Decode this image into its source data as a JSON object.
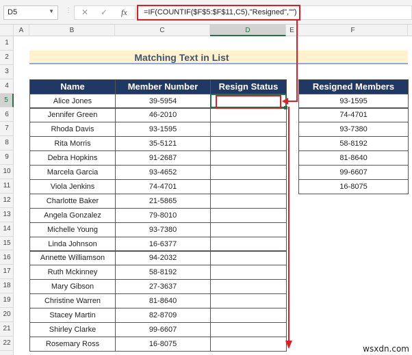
{
  "name_box": "D5",
  "formula_bar": {
    "cancel": "✕",
    "enter": "✓",
    "fx": "fx",
    "formula": "=IF(COUNTIF($F$5:$F$11,C5),\"Resigned\",\"\")"
  },
  "columns": [
    "A",
    "B",
    "C",
    "D",
    "E",
    "F"
  ],
  "rows": [
    "1",
    "2",
    "3",
    "4",
    "5",
    "6",
    "7",
    "8",
    "9",
    "10",
    "11",
    "12",
    "13",
    "14",
    "15",
    "16",
    "17",
    "18",
    "19",
    "20",
    "21",
    "22"
  ],
  "title": "Matching Text in List",
  "headers": {
    "name": "Name",
    "member_number": "Member Number",
    "resign_status": "Resign Status",
    "resigned_members": "Resigned Members"
  },
  "members": [
    {
      "name": "Alice Jones",
      "number": "39-5954",
      "status": ""
    },
    {
      "name": "Jennifer Green",
      "number": "46-2010",
      "status": ""
    },
    {
      "name": "Rhoda Davis",
      "number": "93-1595",
      "status": ""
    },
    {
      "name": "Rita Morris",
      "number": "35-5121",
      "status": ""
    },
    {
      "name": "Debra Hopkins",
      "number": "91-2687",
      "status": ""
    },
    {
      "name": "Marcela Garcia",
      "number": "93-4652",
      "status": ""
    },
    {
      "name": "Viola Jenkins",
      "number": "74-4701",
      "status": ""
    },
    {
      "name": "Charlotte Baker",
      "number": "21-5865",
      "status": ""
    },
    {
      "name": "Angela Gonzalez",
      "number": "79-8010",
      "status": ""
    },
    {
      "name": "Michelle Young",
      "number": "93-7380",
      "status": ""
    },
    {
      "name": "Linda Johnson",
      "number": "16-6377",
      "status": ""
    },
    {
      "name": "Annette Williamson",
      "number": "94-2032",
      "status": ""
    },
    {
      "name": "Ruth Mckinney",
      "number": "58-8192",
      "status": ""
    },
    {
      "name": "Mary Gibson",
      "number": "27-3637",
      "status": ""
    },
    {
      "name": "Christine Warren",
      "number": "81-8640",
      "status": ""
    },
    {
      "name": "Stacey Martin",
      "number": "82-8709",
      "status": ""
    },
    {
      "name": "Shirley Clarke",
      "number": "99-6607",
      "status": ""
    },
    {
      "name": "Rosemary Ross",
      "number": "16-8075",
      "status": ""
    }
  ],
  "resigned": [
    "93-1595",
    "74-4701",
    "93-7380",
    "58-8192",
    "81-8640",
    "99-6607",
    "16-8075"
  ],
  "watermark": "wsxdn.com",
  "colors": {
    "header_bg": "#203864",
    "title_bg": "#fff2cc",
    "annotation": "#e31b23",
    "selection": "#217346"
  }
}
